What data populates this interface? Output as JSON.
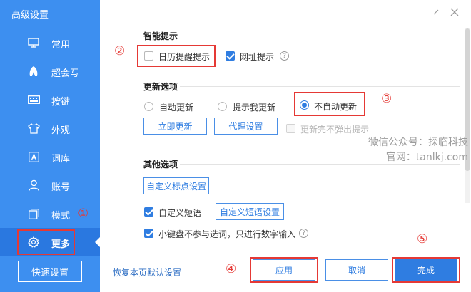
{
  "window": {
    "title": "高级设置"
  },
  "sidebar": {
    "items": [
      {
        "label": "常用",
        "icon": "monitor-icon"
      },
      {
        "label": "超会写",
        "icon": "pen-icon"
      },
      {
        "label": "按键",
        "icon": "keyboard-icon"
      },
      {
        "label": "外观",
        "icon": "shirt-icon"
      },
      {
        "label": "词库",
        "icon": "dictionary-icon"
      },
      {
        "label": "账号",
        "icon": "user-icon"
      },
      {
        "label": "模式",
        "icon": "mode-icon"
      },
      {
        "label": "更多",
        "icon": "gear-icon"
      }
    ],
    "active_index": 7,
    "quick_settings": "快速设置"
  },
  "smart_tips": {
    "title": "智能提示",
    "calendar_reminder": {
      "label": "日历提醒提示",
      "checked": false
    },
    "url_tip": {
      "label": "网址提示",
      "checked": true
    }
  },
  "update": {
    "title": "更新选项",
    "options": [
      {
        "label": "自动更新",
        "selected": false
      },
      {
        "label": "提示我更新",
        "selected": false
      },
      {
        "label": "不自动更新",
        "selected": true
      }
    ],
    "update_now": "立即更新",
    "proxy_settings": "代理设置",
    "no_popup": {
      "label": "更新完不弹出提示",
      "checked": false,
      "disabled": true
    }
  },
  "other": {
    "title": "其他选项",
    "custom_punct": "自定义标点设置",
    "custom_phrase": {
      "label": "自定义短语",
      "checked": true
    },
    "custom_phrase_settings": "自定义短语设置",
    "keypad": {
      "label": "小键盘不参与选词，只进行数字输入",
      "checked": true
    }
  },
  "footer": {
    "restore": "恢复本页默认设置",
    "apply": "应用",
    "cancel": "取消",
    "done": "完成"
  },
  "annotations": [
    "①",
    "②",
    "③",
    "④",
    "⑤"
  ],
  "watermark": {
    "line1": "微信公众号：探临科技",
    "line2": "官网：tanlkj.com"
  },
  "colors": {
    "sidebar": "#3d8ff0",
    "accent": "#2f7de1",
    "annotation": "#e53935"
  }
}
